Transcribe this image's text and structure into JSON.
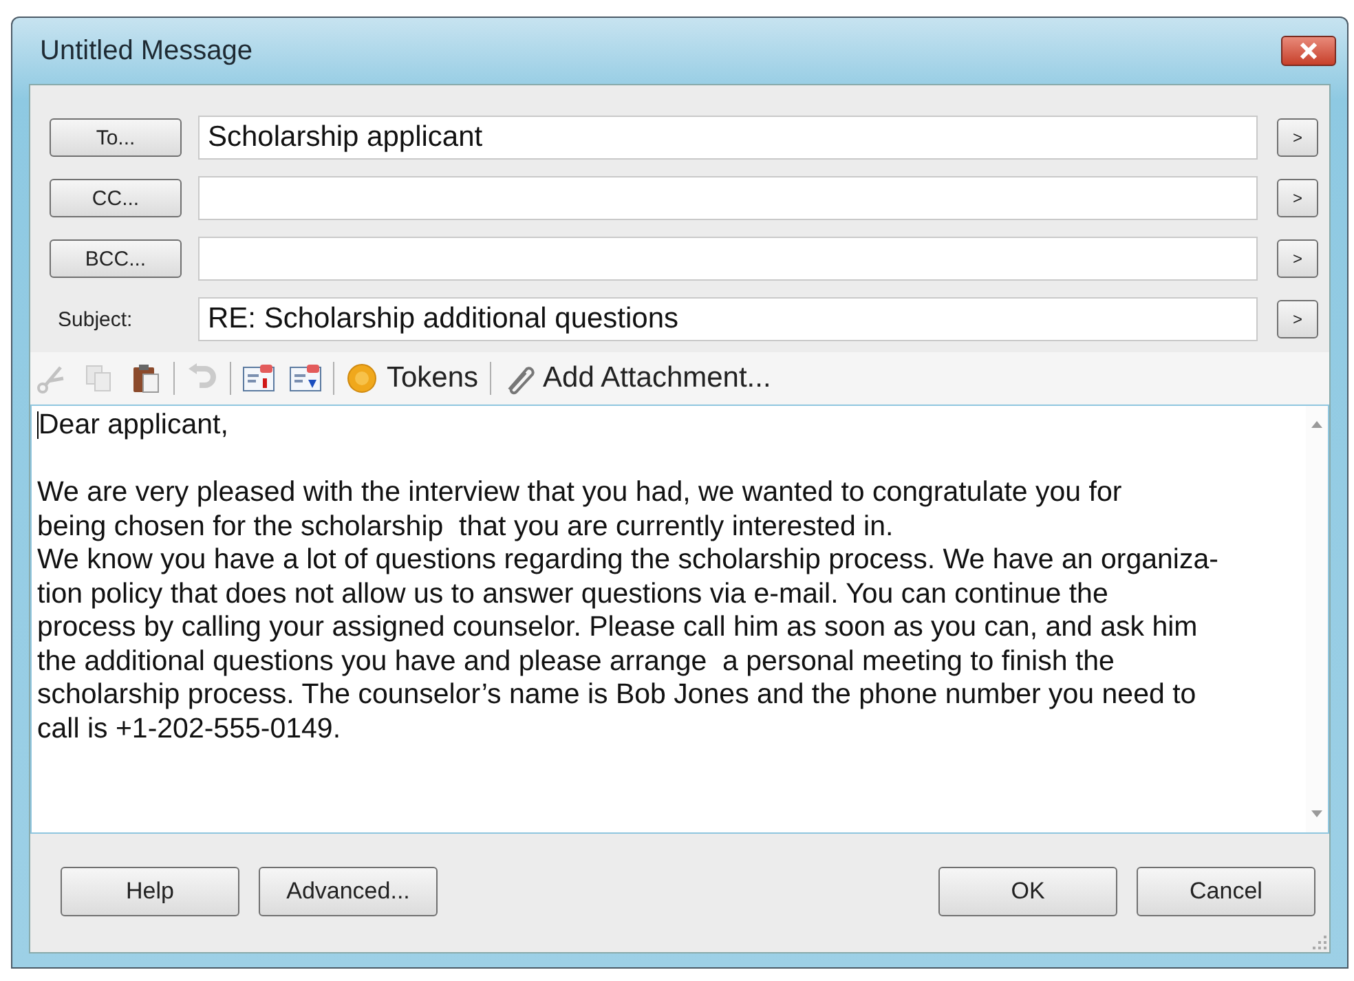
{
  "window": {
    "title": "Untitled Message"
  },
  "address_rows": [
    {
      "kind": "button",
      "label": "To...",
      "value": "Scholarship applicant",
      "expand": ">"
    },
    {
      "kind": "button",
      "label": "CC...",
      "value": "",
      "expand": ">"
    },
    {
      "kind": "button",
      "label": "BCC...",
      "value": "",
      "expand": ">"
    },
    {
      "kind": "label",
      "label": "Subject:",
      "value": "RE: Scholarship additional questions",
      "expand": ">"
    }
  ],
  "toolbar": [
    {
      "kind": "cut",
      "disabled": true
    },
    {
      "kind": "copy",
      "disabled": true
    },
    {
      "kind": "paste",
      "disabled": false
    },
    {
      "kind": "separator"
    },
    {
      "kind": "undo",
      "disabled": true
    },
    {
      "kind": "separator"
    },
    {
      "kind": "field-red",
      "disabled": false
    },
    {
      "kind": "field-blue",
      "disabled": false
    },
    {
      "kind": "separator"
    },
    {
      "kind": "tokens",
      "label": "Tokens",
      "disabled": false
    },
    {
      "kind": "separator"
    },
    {
      "kind": "attachment",
      "label": "Add Attachment...",
      "disabled": false
    }
  ],
  "body": {
    "paragraphs": [
      {
        "lines": [
          "Dear applicant,"
        ]
      },
      {
        "lines": [
          "We are very pleased with the interview that you had, we wanted to congratulate you for",
          "being chosen for the scholarship  that you are currently interested in.",
          "We know you have a lot of questions regarding the scholarship process. We have an organiza-",
          "tion policy that does not allow us to answer questions via e-mail. You can continue the",
          "process by calling your assigned counselor. Please call him as soon as you can, and ask him",
          "the additional questions you have and please arrange  a personal meeting to finish the",
          "scholarship process. The counselor’s name is Bob Jones and the phone number you need to",
          "call is +1-202-555-0149."
        ]
      }
    ]
  },
  "buttons_left": [
    "Help",
    "Advanced..."
  ],
  "buttons_right": [
    "OK",
    "Cancel"
  ]
}
